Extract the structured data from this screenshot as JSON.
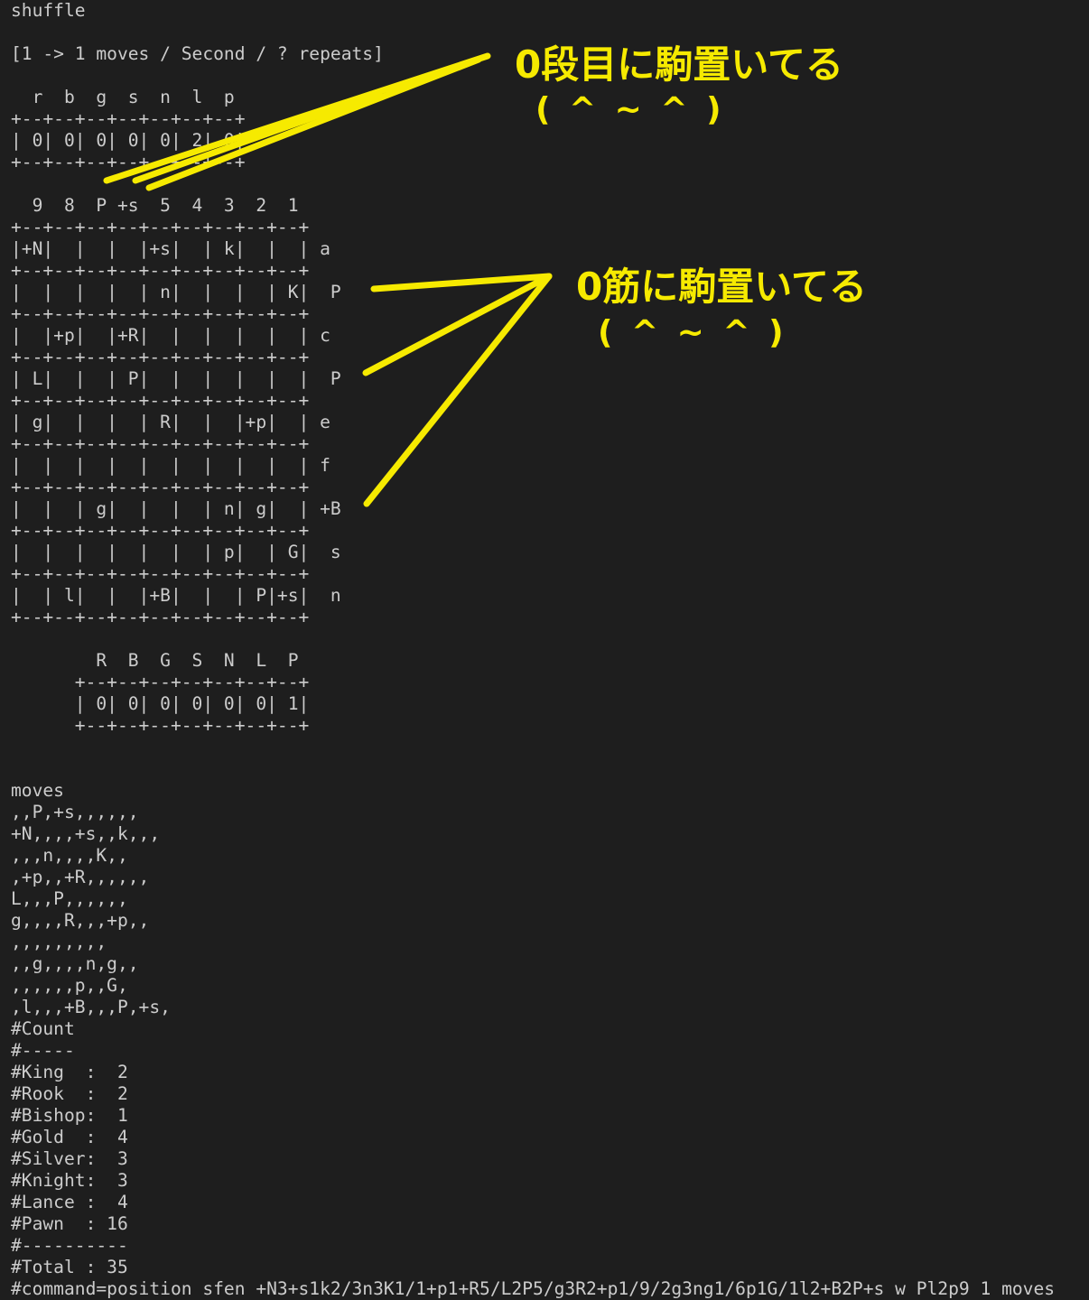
{
  "terminal": {
    "lines": [
      "shuffle",
      "",
      "[1 -> 1 moves / Second / ? repeats]",
      "",
      "  r  b  g  s  n  l  p",
      "+--+--+--+--+--+--+--+",
      "| 0| 0| 0| 0| 0| 2| 0|",
      "+--+--+--+--+--+--+--+",
      "",
      "  9  8  P +s  5  4  3  2  1",
      "+--+--+--+--+--+--+--+--+--+",
      "|+N|  |  |  |+s|  | k|  |  | a",
      "+--+--+--+--+--+--+--+--+--+",
      "|  |  |  |  | n|  |  |  | K|  P",
      "+--+--+--+--+--+--+--+--+--+",
      "|  |+p|  |+R|  |  |  |  |  | c",
      "+--+--+--+--+--+--+--+--+--+",
      "| L|  |  | P|  |  |  |  |  |  P",
      "+--+--+--+--+--+--+--+--+--+",
      "| g|  |  |  | R|  |  |+p|  | e",
      "+--+--+--+--+--+--+--+--+--+",
      "|  |  |  |  |  |  |  |  |  | f",
      "+--+--+--+--+--+--+--+--+--+",
      "|  |  | g|  |  |  | n| g|  | +B",
      "+--+--+--+--+--+--+--+--+--+",
      "|  |  |  |  |  |  | p|  | G|  s",
      "+--+--+--+--+--+--+--+--+--+",
      "|  | l|  |  |+B|  |  | P|+s|  n",
      "+--+--+--+--+--+--+--+--+--+",
      "",
      "        R  B  G  S  N  L  P",
      "      +--+--+--+--+--+--+--+",
      "      | 0| 0| 0| 0| 0| 0| 1|",
      "      +--+--+--+--+--+--+--+",
      "",
      "",
      "moves",
      ",,P,+s,,,,,,",
      "+N,,,,+s,,k,,,",
      ",,,n,,,,K,,",
      ",+p,,+R,,,,,,",
      "L,,,P,,,,,,",
      "g,,,,R,,,+p,,",
      ",,,,,,,,,",
      ",,g,,,,n,g,,",
      ",,,,,,p,,G,",
      ",l,,,+B,,,P,+s,",
      "#Count",
      "#-----",
      "#King  :  2",
      "#Rook  :  2",
      "#Bishop:  1",
      "#Gold  :  4",
      "#Silver:  3",
      "#Knight:  3",
      "#Lance :  4",
      "#Pawn  : 16",
      "#----------",
      "#Total : 35",
      "#command=position sfen +N3+s1k2/3n3K1/1+p1+R5/L2P5/g3R2+p1/9/2g3ng1/6p1G/1l2+B2P+s w Pl2p9 1 moves"
    ]
  },
  "annotations": {
    "rank_note": "0段目に駒置いてる",
    "rank_face": "( ^ ~ ^ )",
    "file_note": "0筋に駒置いてる",
    "file_face": "( ^ ~ ^ )",
    "color": "#f6ea00"
  }
}
